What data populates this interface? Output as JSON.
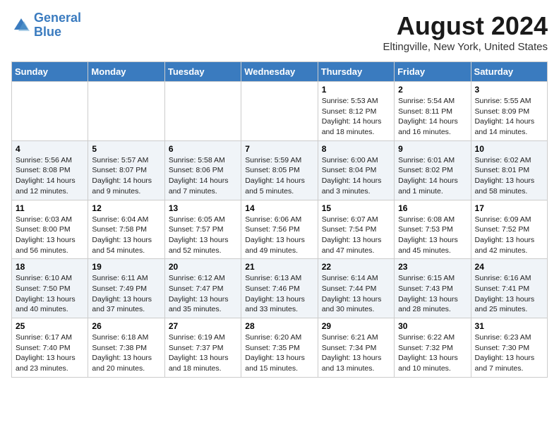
{
  "header": {
    "logo_line1": "General",
    "logo_line2": "Blue",
    "month": "August 2024",
    "location": "Eltingville, New York, United States"
  },
  "weekdays": [
    "Sunday",
    "Monday",
    "Tuesday",
    "Wednesday",
    "Thursday",
    "Friday",
    "Saturday"
  ],
  "weeks": [
    [
      {
        "day": "",
        "content": ""
      },
      {
        "day": "",
        "content": ""
      },
      {
        "day": "",
        "content": ""
      },
      {
        "day": "",
        "content": ""
      },
      {
        "day": "1",
        "content": "Sunrise: 5:53 AM\nSunset: 8:12 PM\nDaylight: 14 hours\nand 18 minutes."
      },
      {
        "day": "2",
        "content": "Sunrise: 5:54 AM\nSunset: 8:11 PM\nDaylight: 14 hours\nand 16 minutes."
      },
      {
        "day": "3",
        "content": "Sunrise: 5:55 AM\nSunset: 8:09 PM\nDaylight: 14 hours\nand 14 minutes."
      }
    ],
    [
      {
        "day": "4",
        "content": "Sunrise: 5:56 AM\nSunset: 8:08 PM\nDaylight: 14 hours\nand 12 minutes."
      },
      {
        "day": "5",
        "content": "Sunrise: 5:57 AM\nSunset: 8:07 PM\nDaylight: 14 hours\nand 9 minutes."
      },
      {
        "day": "6",
        "content": "Sunrise: 5:58 AM\nSunset: 8:06 PM\nDaylight: 14 hours\nand 7 minutes."
      },
      {
        "day": "7",
        "content": "Sunrise: 5:59 AM\nSunset: 8:05 PM\nDaylight: 14 hours\nand 5 minutes."
      },
      {
        "day": "8",
        "content": "Sunrise: 6:00 AM\nSunset: 8:04 PM\nDaylight: 14 hours\nand 3 minutes."
      },
      {
        "day": "9",
        "content": "Sunrise: 6:01 AM\nSunset: 8:02 PM\nDaylight: 14 hours\nand 1 minute."
      },
      {
        "day": "10",
        "content": "Sunrise: 6:02 AM\nSunset: 8:01 PM\nDaylight: 13 hours\nand 58 minutes."
      }
    ],
    [
      {
        "day": "11",
        "content": "Sunrise: 6:03 AM\nSunset: 8:00 PM\nDaylight: 13 hours\nand 56 minutes."
      },
      {
        "day": "12",
        "content": "Sunrise: 6:04 AM\nSunset: 7:58 PM\nDaylight: 13 hours\nand 54 minutes."
      },
      {
        "day": "13",
        "content": "Sunrise: 6:05 AM\nSunset: 7:57 PM\nDaylight: 13 hours\nand 52 minutes."
      },
      {
        "day": "14",
        "content": "Sunrise: 6:06 AM\nSunset: 7:56 PM\nDaylight: 13 hours\nand 49 minutes."
      },
      {
        "day": "15",
        "content": "Sunrise: 6:07 AM\nSunset: 7:54 PM\nDaylight: 13 hours\nand 47 minutes."
      },
      {
        "day": "16",
        "content": "Sunrise: 6:08 AM\nSunset: 7:53 PM\nDaylight: 13 hours\nand 45 minutes."
      },
      {
        "day": "17",
        "content": "Sunrise: 6:09 AM\nSunset: 7:52 PM\nDaylight: 13 hours\nand 42 minutes."
      }
    ],
    [
      {
        "day": "18",
        "content": "Sunrise: 6:10 AM\nSunset: 7:50 PM\nDaylight: 13 hours\nand 40 minutes."
      },
      {
        "day": "19",
        "content": "Sunrise: 6:11 AM\nSunset: 7:49 PM\nDaylight: 13 hours\nand 37 minutes."
      },
      {
        "day": "20",
        "content": "Sunrise: 6:12 AM\nSunset: 7:47 PM\nDaylight: 13 hours\nand 35 minutes."
      },
      {
        "day": "21",
        "content": "Sunrise: 6:13 AM\nSunset: 7:46 PM\nDaylight: 13 hours\nand 33 minutes."
      },
      {
        "day": "22",
        "content": "Sunrise: 6:14 AM\nSunset: 7:44 PM\nDaylight: 13 hours\nand 30 minutes."
      },
      {
        "day": "23",
        "content": "Sunrise: 6:15 AM\nSunset: 7:43 PM\nDaylight: 13 hours\nand 28 minutes."
      },
      {
        "day": "24",
        "content": "Sunrise: 6:16 AM\nSunset: 7:41 PM\nDaylight: 13 hours\nand 25 minutes."
      }
    ],
    [
      {
        "day": "25",
        "content": "Sunrise: 6:17 AM\nSunset: 7:40 PM\nDaylight: 13 hours\nand 23 minutes."
      },
      {
        "day": "26",
        "content": "Sunrise: 6:18 AM\nSunset: 7:38 PM\nDaylight: 13 hours\nand 20 minutes."
      },
      {
        "day": "27",
        "content": "Sunrise: 6:19 AM\nSunset: 7:37 PM\nDaylight: 13 hours\nand 18 minutes."
      },
      {
        "day": "28",
        "content": "Sunrise: 6:20 AM\nSunset: 7:35 PM\nDaylight: 13 hours\nand 15 minutes."
      },
      {
        "day": "29",
        "content": "Sunrise: 6:21 AM\nSunset: 7:34 PM\nDaylight: 13 hours\nand 13 minutes."
      },
      {
        "day": "30",
        "content": "Sunrise: 6:22 AM\nSunset: 7:32 PM\nDaylight: 13 hours\nand 10 minutes."
      },
      {
        "day": "31",
        "content": "Sunrise: 6:23 AM\nSunset: 7:30 PM\nDaylight: 13 hours\nand 7 minutes."
      }
    ]
  ]
}
